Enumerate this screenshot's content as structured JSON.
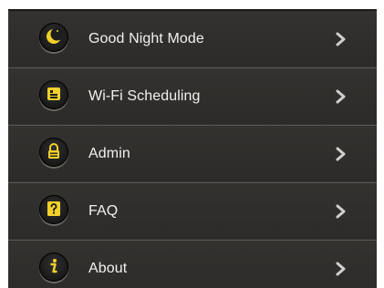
{
  "menu": {
    "items": [
      {
        "label": "Good Night Mode",
        "icon": "moon-icon"
      },
      {
        "label": "Wi-Fi Scheduling",
        "icon": "scheduling-icon"
      },
      {
        "label": "Admin",
        "icon": "lock-icon"
      },
      {
        "label": "FAQ",
        "icon": "question-icon"
      },
      {
        "label": "About",
        "icon": "info-icon"
      }
    ]
  },
  "colors": {
    "background": "#2f2d2b",
    "text": "#f1f1f1",
    "icon_accent": "#f2d12a",
    "chevron": "#cfcfcf"
  }
}
